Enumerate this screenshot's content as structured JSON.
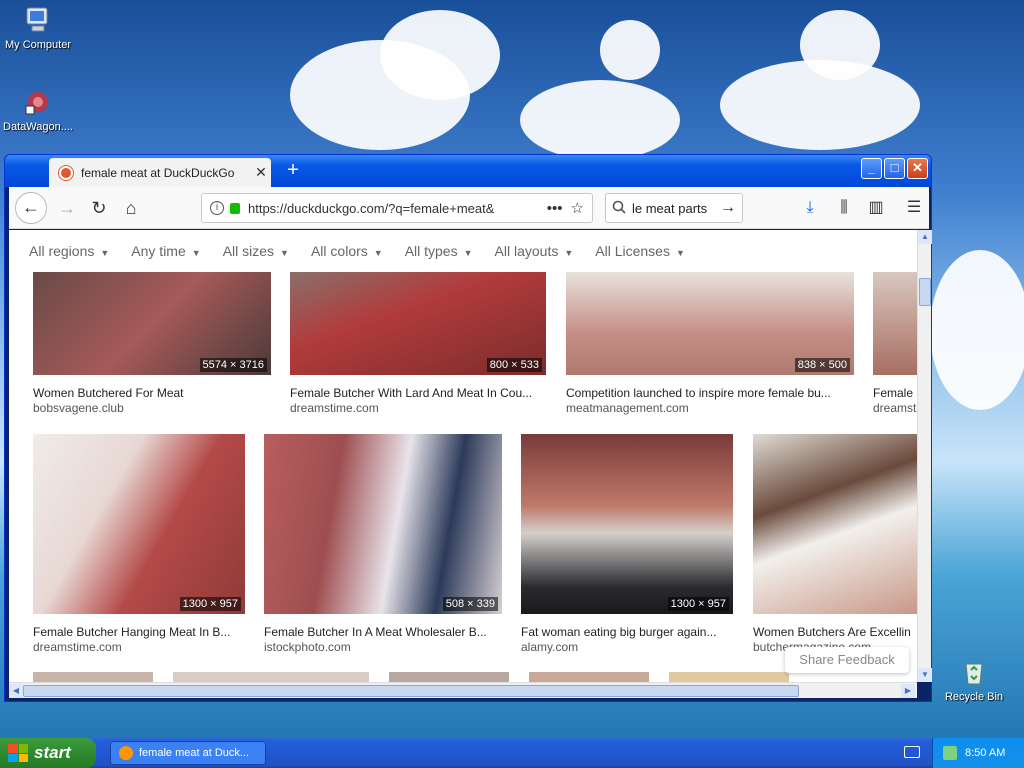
{
  "desktop": {
    "icons": [
      {
        "label": "My Computer",
        "icon": "my-computer-icon"
      },
      {
        "label": "DataWagon....",
        "icon": "datawagon-icon"
      },
      {
        "label": "Recycle Bin",
        "icon": "recycle-bin-icon"
      }
    ]
  },
  "browser": {
    "tab_title": "female meat at DuckDuckGo",
    "new_tab": "+",
    "url": "https://duckduckgo.com/?q=female+meat&",
    "search_query": "le meat parts",
    "filters": [
      "All regions",
      "Any time",
      "All sizes",
      "All colors",
      "All types",
      "All layouts",
      "All Licenses"
    ],
    "share_feedback": "Share Feedback",
    "results_row1": [
      {
        "caption": "Women Butchered For Meat",
        "source": "bobsvagene.club",
        "dims": "5574 × 3716",
        "color": "#8a5a55"
      },
      {
        "caption": "Female Butcher With Lard And Meat In Cou...",
        "source": "dreamstime.com",
        "dims": "800 × 533",
        "color": "#a8433f"
      },
      {
        "caption": "Competition launched to inspire more female bu...",
        "source": "meatmanagement.com",
        "dims": "838 × 500",
        "color": "#c9a7a0"
      },
      {
        "caption": "Female",
        "source": "dreamst",
        "dims": "",
        "color": "#b98a7e"
      }
    ],
    "results_row2": [
      {
        "caption": "Female Butcher Hanging Meat In B...",
        "source": "dreamstime.com",
        "dims": "1300 × 957",
        "color": "#b5605a"
      },
      {
        "caption": "Female Butcher In A Meat Wholesaler B...",
        "source": "istockphoto.com",
        "dims": "508 × 339",
        "color": "#9c5f5c"
      },
      {
        "caption": "Fat woman eating big burger again...",
        "source": "alamy.com",
        "dims": "1300 × 957",
        "color": "#7b5b55"
      },
      {
        "caption": "Women Butchers Are Excellin",
        "source": "butchermagazine.com",
        "dims": "",
        "color": "#8d6d60"
      }
    ]
  },
  "taskbar": {
    "start_label": "start",
    "task_label": "female meat at Duck...",
    "clock": "8:50 AM"
  }
}
